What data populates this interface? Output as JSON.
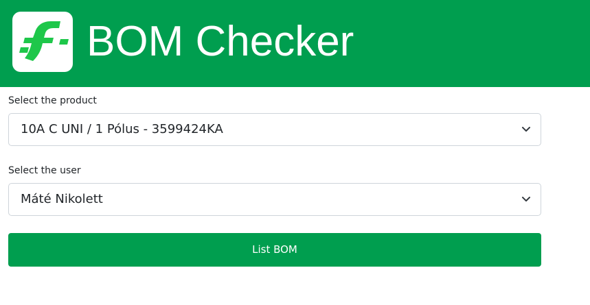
{
  "header": {
    "title": "BOM Checker",
    "logo_icon": "brand-s-logo-icon",
    "background_color": "#009e4f"
  },
  "form": {
    "product_label": "Select the product",
    "product_value": "10A C UNI / 1 Pólus - 3599424KA",
    "user_label": "Select the user",
    "user_value": "Máté Nikolett",
    "submit_label": "List BOM",
    "dropdown_icon": "chevron-down-icon"
  },
  "colors": {
    "accent": "#009e4f",
    "logo_green": "#1ec74a"
  }
}
